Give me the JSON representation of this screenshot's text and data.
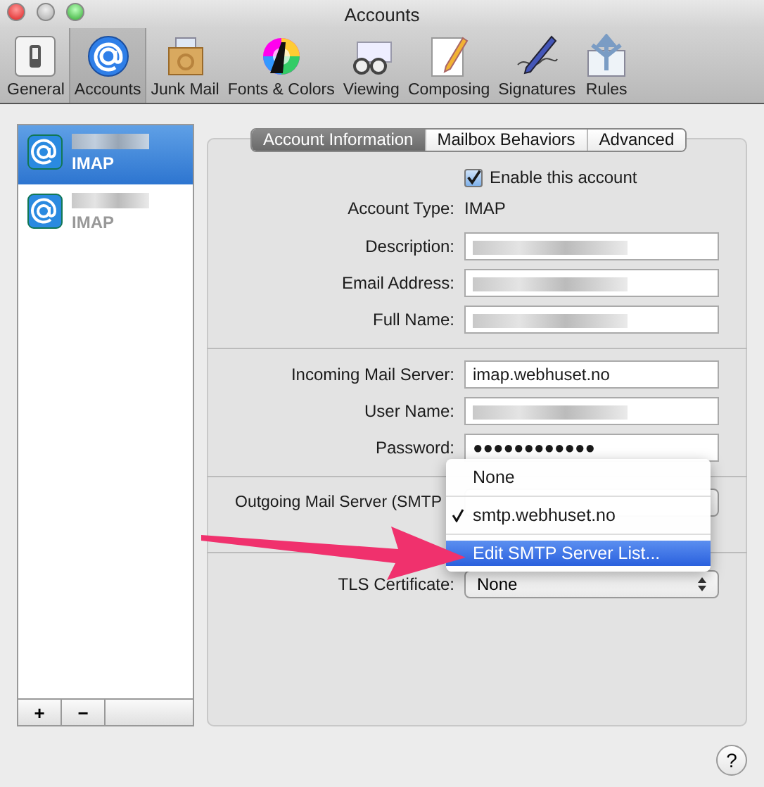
{
  "window": {
    "title": "Accounts"
  },
  "toolbar": [
    {
      "label": "General",
      "selected": false
    },
    {
      "label": "Accounts",
      "selected": true
    },
    {
      "label": "Junk Mail",
      "selected": false
    },
    {
      "label": "Fonts & Colors",
      "selected": false
    },
    {
      "label": "Viewing",
      "selected": false
    },
    {
      "label": "Composing",
      "selected": false
    },
    {
      "label": "Signatures",
      "selected": false
    },
    {
      "label": "Rules",
      "selected": false
    }
  ],
  "accounts": [
    {
      "type": "IMAP",
      "selected": true
    },
    {
      "type": "IMAP",
      "selected": false
    }
  ],
  "list_buttons": [
    "+",
    "−"
  ],
  "tabs": [
    {
      "label": "Account Information",
      "selected": true
    },
    {
      "label": "Mailbox Behaviors",
      "selected": false
    },
    {
      "label": "Advanced",
      "selected": false
    }
  ],
  "enable_account": {
    "label": "Enable this account",
    "checked": true
  },
  "account_type": {
    "label": "Account Type:",
    "value": "IMAP"
  },
  "field_groups": [
    [
      {
        "label": "Description:"
      },
      {
        "label": "Email Address:"
      },
      {
        "label": "Full Name:"
      }
    ],
    [
      {
        "label": "Incoming Mail Server:",
        "value": "imap.webhuset.no"
      },
      {
        "label": "User Name:"
      },
      {
        "label": "Password:",
        "value": "●●●●●●●●●●●●"
      }
    ]
  ],
  "outgoing": {
    "label": "Outgoing Mail Server (SMTP",
    "menu": [
      {
        "label": "None",
        "checked": false,
        "selected": false
      },
      {
        "label": "smtp.webhuset.no",
        "checked": true,
        "selected": false
      },
      {
        "label": "Edit SMTP Server List...",
        "checked": false,
        "selected": true
      }
    ]
  },
  "tls": {
    "label": "TLS Certificate:",
    "value": "None"
  },
  "help_button": "?"
}
